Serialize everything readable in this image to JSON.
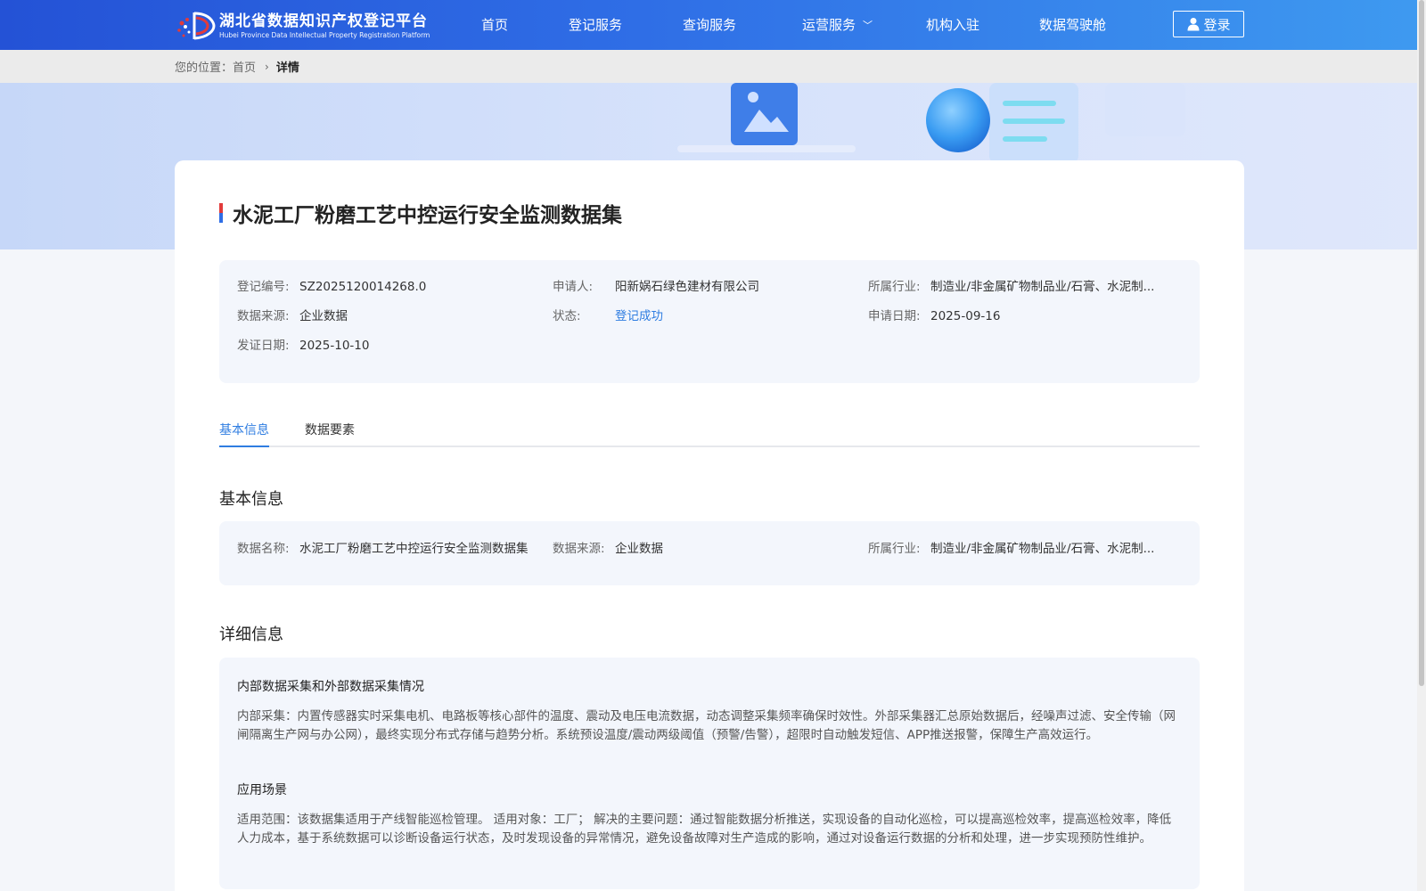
{
  "header": {
    "logo_title": "湖北省数据知识产权登记平台",
    "logo_subtitle": "Hubei Province Data Intellectual Property Registration Platform",
    "nav": [
      "首页",
      "登记服务",
      "查询服务",
      "运营服务",
      "机构入驻",
      "数据驾驶舱"
    ],
    "login_label": "登录"
  },
  "breadcrumb": {
    "prefix": "您的位置：",
    "home": "首页",
    "current": "详情"
  },
  "detail": {
    "title": "水泥工厂粉磨工艺中控运行安全监测数据集",
    "summary": {
      "reg_no_label": "登记编号:",
      "reg_no": "SZ2025120014268.0",
      "applicant_label": "申请人:",
      "applicant": "阳新娲石绿色建材有限公司",
      "industry_label": "所属行业:",
      "industry": "制造业/非金属矿物制品业/石膏、水泥制...",
      "source_label": "数据来源:",
      "source": "企业数据",
      "status_label": "状态:",
      "status": "登记成功",
      "apply_date_label": "申请日期:",
      "apply_date": "2025-09-16",
      "issue_date_label": "发证日期:",
      "issue_date": "2025-10-10"
    },
    "tabs": [
      "基本信息",
      "数据要素"
    ],
    "basic": {
      "section_title": "基本信息",
      "name_label": "数据名称:",
      "name": "水泥工厂粉磨工艺中控运行安全监测数据集",
      "source_label": "数据来源:",
      "source": "企业数据",
      "industry_label": "所属行业:",
      "industry": "制造业/非金属矿物制品业/石膏、水泥制..."
    },
    "more": {
      "section_title": "详细信息",
      "collection_heading": "内部数据采集和外部数据采集情况",
      "collection_text": "内部采集：内置传感器实时采集电机、电路板等核心部件的温度、震动及电压电流数据，动态调整采集频率确保时效性。外部采集器汇总原始数据后，经噪声过滤、安全传输（网闸隔离生产网与办公网），最终实现分布式存储与趋势分析。系统预设温度/震动两级阈值（预警/告警），超限时自动触发短信、APP推送报警，保障生产高效运行。",
      "scene_heading": "应用场景",
      "scene_text": "适用范围：该数据集适用于产线智能巡检管理。 适用对象：工厂； 解决的主要问题：通过智能数据分析推送，实现设备的自动化巡检，可以提高巡检效率，提高巡检效率，降低人力成本，基于系统数据可以诊断设备运行状态，及时发现设备的异常情况，避免设备故障对生产造成的影响，通过对设备运行数据的分析和处理，进一步实现预防性维护。"
    }
  }
}
